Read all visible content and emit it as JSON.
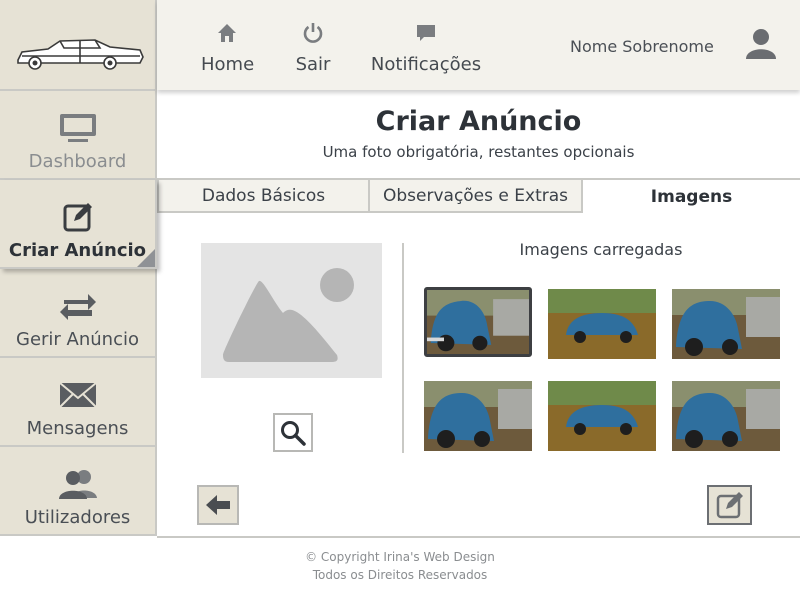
{
  "nav": {
    "home_label": "Home",
    "logout_label": "Sair",
    "notifications_label": "Notificações",
    "user_name": "Nome Sobrenome"
  },
  "sidebar": {
    "items": [
      {
        "label": "Dashboard",
        "icon": "monitor-icon"
      },
      {
        "label": "Criar Anúncio",
        "icon": "edit-icon",
        "active": true
      },
      {
        "label": "Gerir Anúncio",
        "icon": "swap-arrows-icon"
      },
      {
        "label": "Mensagens",
        "icon": "envelope-icon"
      },
      {
        "label": "Utilizadores",
        "icon": "users-icon"
      }
    ]
  },
  "main": {
    "title": "Criar Anúncio",
    "subtitle": "Uma foto obrigatória, restantes opcionais",
    "tabs": [
      {
        "label": "Dados Básicos"
      },
      {
        "label": "Observações e Extras"
      },
      {
        "label": "Imagens",
        "active": true
      }
    ],
    "uploaded_title": "Imagens carregadas"
  },
  "footer": {
    "line1": "© Copyright Irina's Web Design",
    "line2": "Todos os Direitos Reservados"
  },
  "colors": {
    "sidebar_bg": "#e6e2d5",
    "topbar_bg": "#f3f2ec",
    "border": "#c9c9c5",
    "text_dark": "#2d3238",
    "car_blue": "#2f6f9e"
  }
}
